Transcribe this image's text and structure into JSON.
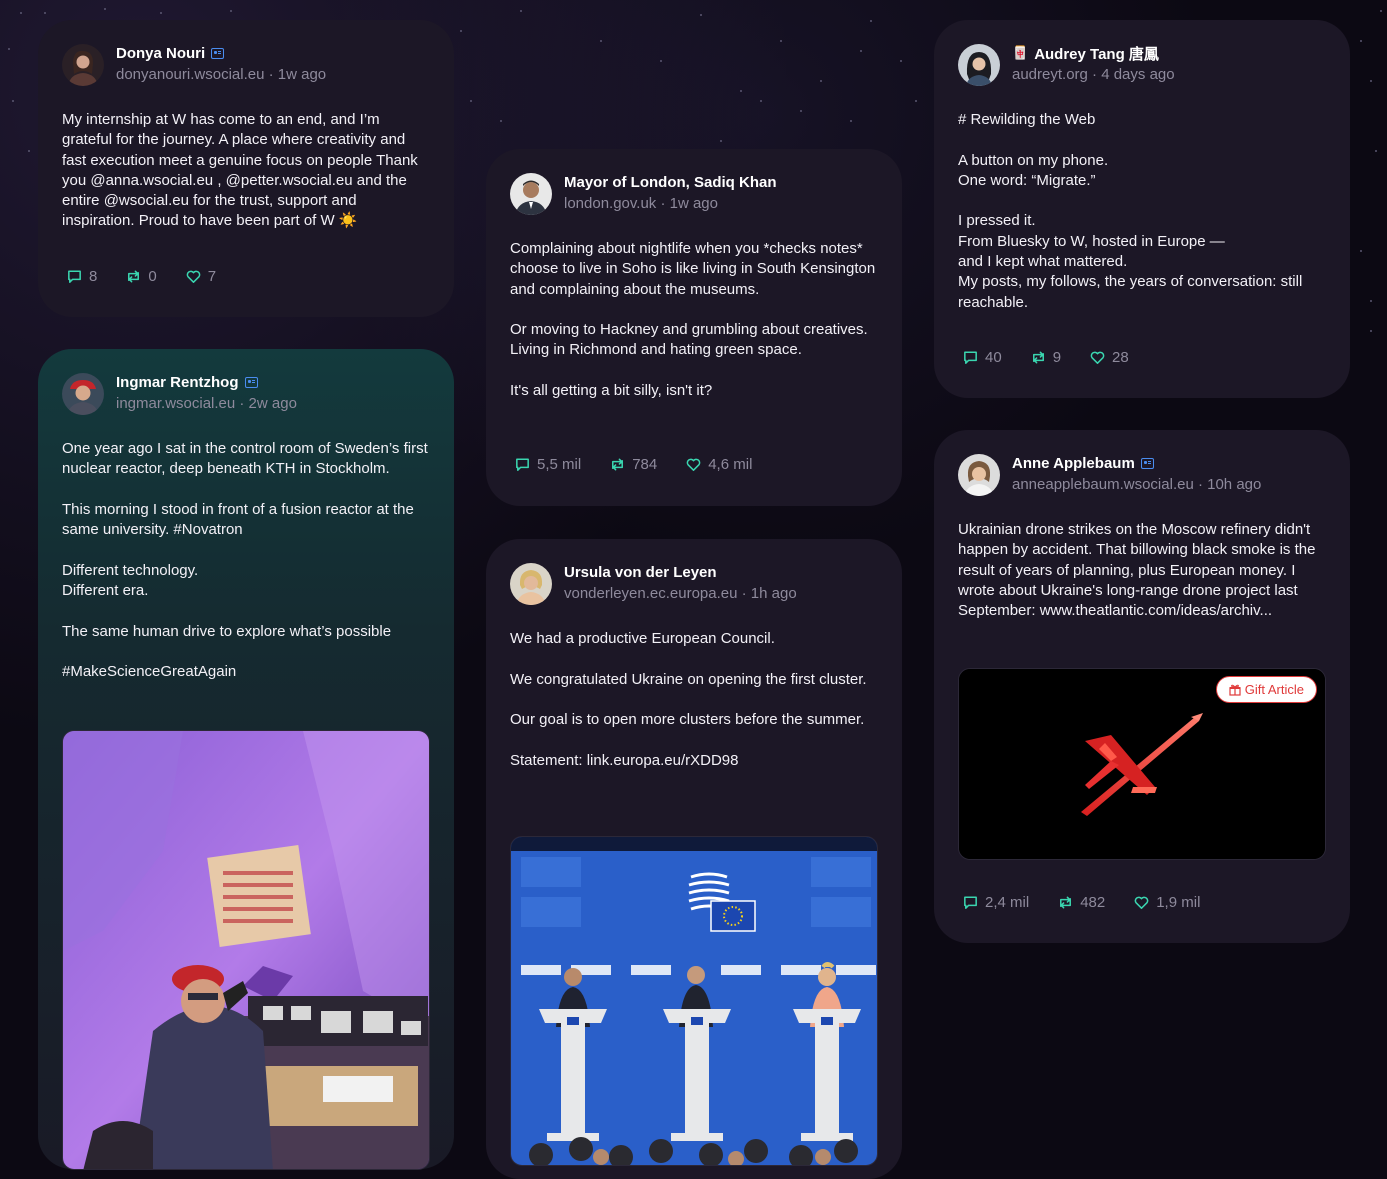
{
  "posts": {
    "donya": {
      "name": "Donya Nouri",
      "handle": "donyanouri.wsocial.eu · 1w ago",
      "text": "My internship at W has come to an end, and I’m grateful for the journey. A place where creativity and fast execution meet a genuine focus on people Thank you @anna.wsocial.eu , @petter.wsocial.eu and the entire @wsocial.eu for the trust, support and inspiration. Proud to have been part of W ☀️",
      "replies": "8",
      "reposts": "0",
      "likes": "7"
    },
    "ingmar": {
      "name": "Ingmar Rentzhog",
      "handle": "ingmar.wsocial.eu · 2w ago",
      "text": "One year ago I sat in the control room of Sweden’s first nuclear reactor, deep beneath KTH in Stockholm.\n\nThis morning I stood in front of a fusion reactor at the same university. #Novatron\n\nDifferent technology.\nDifferent era.\n\nThe same human drive to explore what’s possible\n\n#MakeScienceGreatAgain"
    },
    "sadiq": {
      "name": "Mayor of London, Sadiq Khan",
      "handle": "london.gov.uk · 1w ago",
      "text": "Complaining about nightlife when you *checks notes* choose to live in Soho is like living in South Kensington and complaining about the museums.\n\nOr moving to Hackney and grumbling about creatives. Living in Richmond and hating green space.\n\nIt's all getting a bit silly, isn't it?",
      "replies": "5,5 mil",
      "reposts": "784",
      "likes": "4,6 mil"
    },
    "ursula": {
      "name": "Ursula von der Leyen",
      "handle": "vonderleyen.ec.europa.eu · 1h ago",
      "text": "We had a productive European Council.\n\nWe congratulated Ukraine on opening the first cluster.\n\nOur goal is to open more clusters before the summer.\n\nStatement: link.europa.eu/rXDD98"
    },
    "audrey": {
      "name": "Audrey Tang 唐鳳",
      "name_prefix": "🀄",
      "handle": "audreyt.org · 4 days ago",
      "text": "# Rewilding the Web\n\nA button on my phone.\nOne word: “Migrate.”\n\nI pressed it.\nFrom Bluesky to W, hosted in Europe —\nand I kept what mattered.\nMy posts, my follows, the years of conversation: still reachable.",
      "replies": "40",
      "reposts": "9",
      "likes": "28"
    },
    "anne": {
      "name": "Anne Applebaum",
      "handle": "anneapplebaum.wsocial.eu · 10h ago",
      "text": "Ukrainian drone strikes on the Moscow refinery didn't happen by accident. That billowing black smoke is the result of years of planning, plus European money. I wrote about Ukraine's long-range drone project last September: www.theatlantic.com/ideas/archiv...",
      "gift_label": "Gift Article",
      "replies": "2,4 mil",
      "reposts": "482",
      "likes": "1,9 mil"
    }
  },
  "colors": {
    "card": "#1c1726",
    "repost": "#3ad6b0",
    "reply": "#3ad6b0",
    "like": "#3ad6b0",
    "verified": "#4a8df0",
    "gift": "#e03a3a"
  },
  "icons": [
    "reply-icon",
    "repost-icon",
    "like-icon",
    "verified-icon",
    "gift-icon"
  ]
}
